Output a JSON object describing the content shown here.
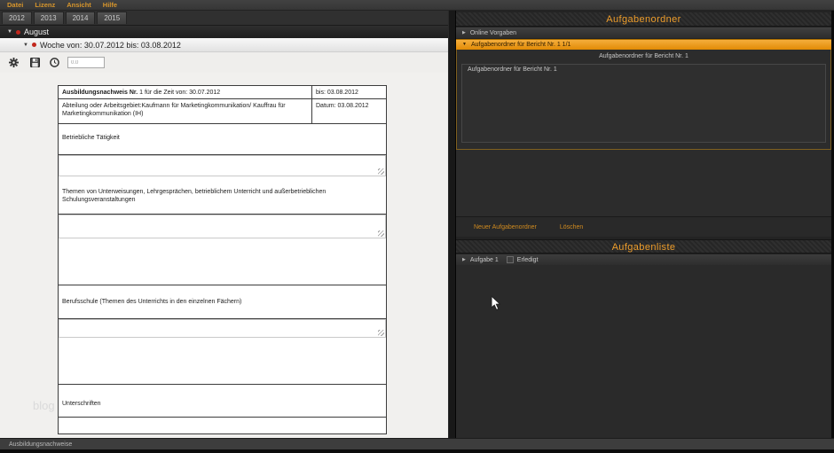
{
  "menubar": {
    "items": [
      "Datei",
      "Lizenz",
      "Ansicht",
      "Hilfe"
    ]
  },
  "year_tabs": [
    "2012",
    "2013",
    "2014",
    "2015"
  ],
  "left_panel": {
    "month_row": {
      "label": "August"
    },
    "week_row": {
      "label": "Woche von: 30.07.2012 bis: 03.08.2012"
    },
    "toolbar": {
      "hours_value": "0.0"
    },
    "watermark": "blog",
    "form": {
      "report_title_bold": "Ausbildungsnachweis Nr.",
      "report_title_rest": " 1 für die Zeit von: 30.07.2012",
      "bis_label": "bis: 03.08.2012",
      "department": "Abteilung oder Arbeitsgebiet:Kaufmann für Marketingkommunikation/ Kauffrau für Marketingkommunikation (IH)",
      "datum_label": "Datum: 03.08.2012",
      "section_betrieb": "Betriebliche Tätigkeit",
      "section_themen": "Themen von Unterweisungen, Lehrgesprächen, betrieblichem Unterricht und außerbetrieblichen Schulungsveranstaltungen",
      "section_berufsschule": "Berufsschule (Themen des Unterrichts in den einzelnen Fächern)",
      "section_unterschriften": "Unterschriften"
    }
  },
  "right_panel": {
    "folders": {
      "header": "Aufgabenordner",
      "collapsed_item": "Online Vorgaben",
      "selected_item": "Aufgabenordner für Bericht Nr. 1 1/1",
      "panel_title": "Aufgabenordner für Bericht Nr. 1",
      "list_item": "Aufgabenordner für Bericht Nr. 1",
      "new_button": "Neuer Aufgabenordner",
      "delete_button": "Löschen"
    },
    "tasks": {
      "header": "Aufgabenliste",
      "item_label": "Aufgabe 1",
      "done_label": "Erledigt",
      "done_checked": false
    }
  },
  "statusbar": {
    "text": "Ausbildungsnachweise"
  },
  "colors": {
    "accent_orange": "#ee9d2b",
    "selected_row_orange": "#e89010",
    "alert_red": "#c2271d"
  }
}
